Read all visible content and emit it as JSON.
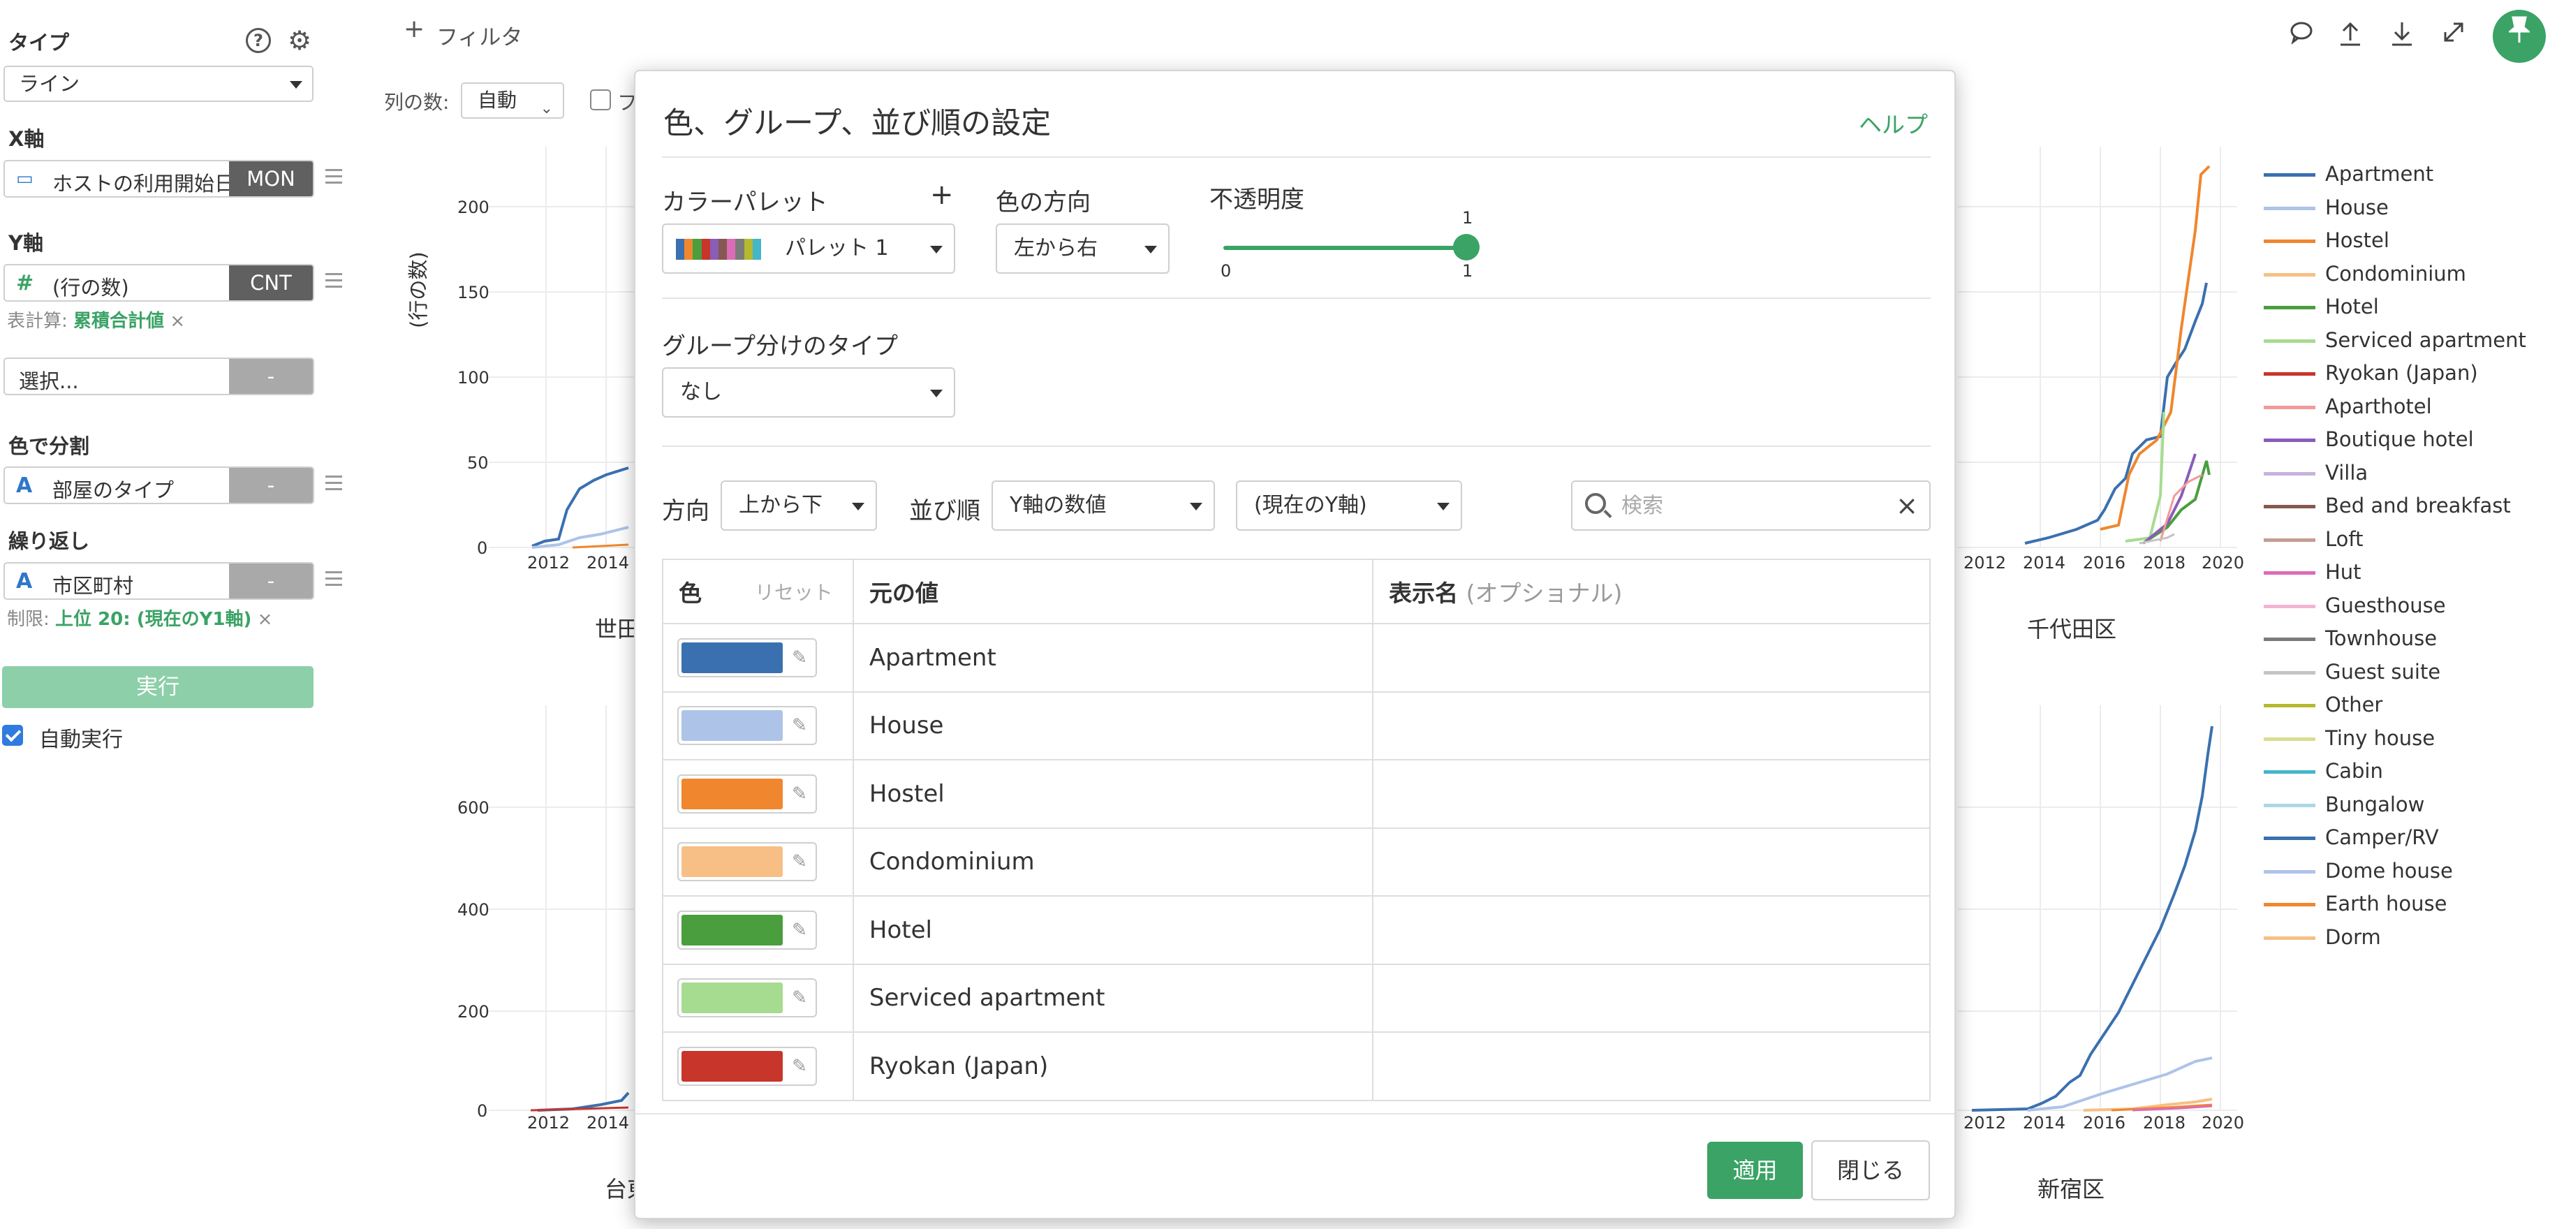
{
  "sidebar": {
    "type_label": "タイプ",
    "type_value": "ライン",
    "xaxis_label": "X軸",
    "xaxis_field": "ホストの利用開始日",
    "xaxis_tag": "MON",
    "yaxis_label": "Y軸",
    "yaxis_field": "(行の数)",
    "yaxis_tag": "CNT",
    "table_calc_label": "表計算:",
    "table_calc_value": "累積合計値",
    "select_placeholder": "選択...",
    "select_tag": "-",
    "color_split_label": "色で分割",
    "color_split_field": "部屋のタイプ",
    "color_split_tag": "-",
    "repeat_label": "繰り返し",
    "repeat_field": "市区町村",
    "repeat_tag": "-",
    "limit_label": "制限:",
    "limit_value": "上位 20: (現在のY1軸)",
    "remove_glyph": "×",
    "run_label": "実行",
    "auto_run_label": "自動実行",
    "auto_run_checked": true
  },
  "toolbar": {
    "filter_label": "フィルタ",
    "columns_label": "列の数:",
    "columns_value": "自動",
    "checkbox_partial_label": "フ"
  },
  "background_charts": {
    "y_axis_label": "(行の数)",
    "x_ticks": [
      "2012",
      "2014",
      "2016",
      "2018",
      "2020"
    ],
    "top_left": {
      "title_partial": "世田",
      "y_ticks": [
        "0",
        "50",
        "100",
        "150",
        "200"
      ]
    },
    "bottom_left": {
      "title_partial": "台東",
      "y_ticks": [
        "0",
        "200",
        "400",
        "600"
      ]
    },
    "top_right": {
      "title": "千代田区",
      "visible_x_ticks": [
        "2012",
        "2014",
        "2016",
        "2018",
        "2020"
      ]
    },
    "bottom_right": {
      "title": "新宿区",
      "visible_x_ticks": [
        "2012",
        "2014",
        "2016",
        "2018",
        "2020"
      ]
    }
  },
  "legend": [
    {
      "label": "Apartment",
      "color": "#3a70b0"
    },
    {
      "label": "House",
      "color": "#aec3e8"
    },
    {
      "label": "Hostel",
      "color": "#f0862e"
    },
    {
      "label": "Condominium",
      "color": "#f7bf86"
    },
    {
      "label": "Hotel",
      "color": "#4a9e3e"
    },
    {
      "label": "Serviced apartment",
      "color": "#a6dc90"
    },
    {
      "label": "Ryokan (Japan)",
      "color": "#c8352b"
    },
    {
      "label": "Aparthotel",
      "color": "#f29a99"
    },
    {
      "label": "Boutique hotel",
      "color": "#8a5db8"
    },
    {
      "label": "Villa",
      "color": "#c6b3dd"
    },
    {
      "label": "Bed and breakfast",
      "color": "#86584f"
    },
    {
      "label": "Loft",
      "color": "#c59c93"
    },
    {
      "label": "Hut",
      "color": "#dd6bb8"
    },
    {
      "label": "Guesthouse",
      "color": "#f4b4d3"
    },
    {
      "label": "Townhouse",
      "color": "#7b7b7b"
    },
    {
      "label": "Guest suite",
      "color": "#c4c4c4"
    },
    {
      "label": "Other",
      "color": "#b5b92e"
    },
    {
      "label": "Tiny house",
      "color": "#dadd91"
    },
    {
      "label": "Cabin",
      "color": "#43b6c9"
    },
    {
      "label": "Bungalow",
      "color": "#a9d8e4"
    },
    {
      "label": "Camper/RV",
      "color": "#3a70b0"
    },
    {
      "label": "Dome house",
      "color": "#aec3e8"
    },
    {
      "label": "Earth house",
      "color": "#f0862e"
    },
    {
      "label": "Dorm",
      "color": "#f7bf86"
    }
  ],
  "modal": {
    "title": "色、グループ、並び順の設定",
    "help": "ヘルプ",
    "palette_label": "カラーパレット",
    "palette_add": "+",
    "palette_value": "パレット 1",
    "palette_colors": [
      "#3a70b0",
      "#f0862e",
      "#4a9e3e",
      "#c8352b",
      "#8a5db8",
      "#86584f",
      "#dd6bb8",
      "#7b7b7b",
      "#b5b92e",
      "#43b6c9"
    ],
    "direction_label": "色の方向",
    "direction_value": "左から右",
    "opacity_label": "不透明度",
    "opacity_min": "0",
    "opacity_max": "1",
    "opacity_value": "1",
    "opacity_fraction": 1,
    "group_type_label": "グループ分けのタイプ",
    "group_type_value": "なし",
    "order_dir_label": "方向",
    "order_dir_value": "上から下",
    "sort_label": "並び順",
    "sort_value": "Y軸の数値",
    "sort_axis_value": "(現在のY軸)",
    "search_placeholder": "検索",
    "table": {
      "col_color": "色",
      "col_reset": "リセット",
      "col_original": "元の値",
      "col_display": "表示名",
      "col_display_optional": "(オプショナル)",
      "rows": [
        {
          "label": "Apartment",
          "color": "#3a70b0",
          "display": ""
        },
        {
          "label": "House",
          "color": "#aec3e8",
          "display": ""
        },
        {
          "label": "Hostel",
          "color": "#f0862e",
          "display": ""
        },
        {
          "label": "Condominium",
          "color": "#f7bf86",
          "display": ""
        },
        {
          "label": "Hotel",
          "color": "#4a9e3e",
          "display": ""
        },
        {
          "label": "Serviced apartment",
          "color": "#a6dc90",
          "display": ""
        },
        {
          "label": "Ryokan (Japan)",
          "color": "#c8352b",
          "display": ""
        }
      ]
    },
    "apply_label": "適用",
    "close_label": "閉じる"
  }
}
